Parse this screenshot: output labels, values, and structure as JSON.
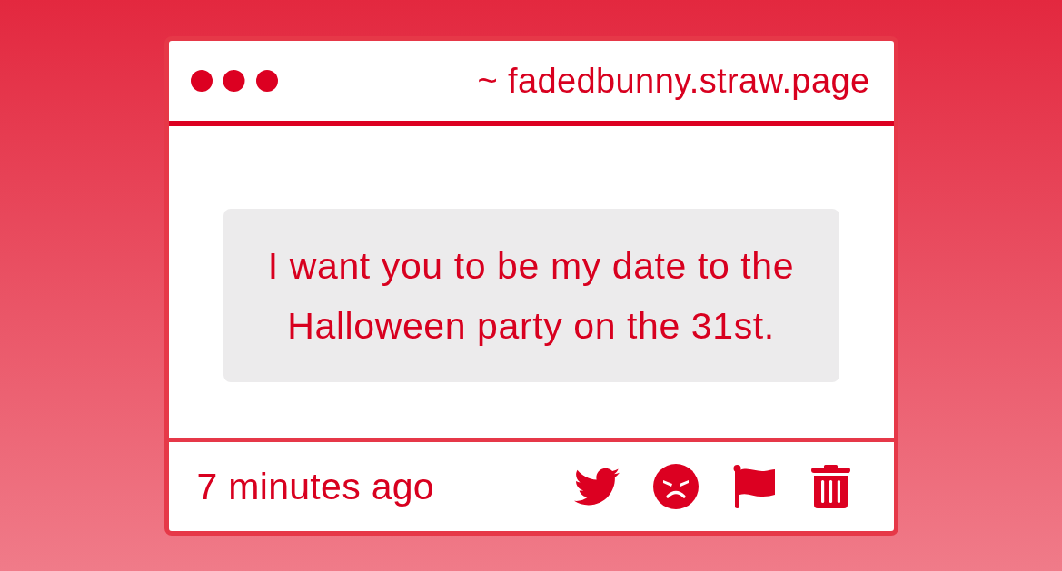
{
  "window": {
    "address": "~ fadedbunny.straw.page"
  },
  "message": {
    "text": "I want you to be my date to the Halloween party on the 31st."
  },
  "footer": {
    "time": "7 minutes ago"
  }
}
